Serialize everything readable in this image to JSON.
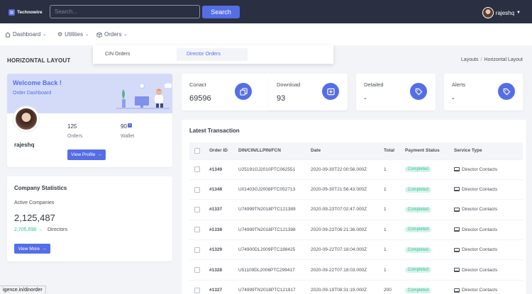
{
  "brand": {
    "name": "Technowire"
  },
  "search": {
    "placeholder": "Search...",
    "button_label": "Search"
  },
  "user": {
    "name": "rajeshq"
  },
  "nav": {
    "items": [
      {
        "label": "Dashboard",
        "icon": "home-icon"
      },
      {
        "label": "Utilities",
        "icon": "gear-icon"
      },
      {
        "label": "Orders",
        "icon": "box-icon"
      }
    ]
  },
  "orders_menu": {
    "items": [
      "CIN Orders",
      "Director Orders"
    ],
    "active": "Director Orders"
  },
  "page": {
    "title": "HORIZONTAL LAYOUT",
    "breadcrumb": [
      "Layouts",
      "Horizontal Layout"
    ]
  },
  "welcome": {
    "title": "Welcome Back !",
    "subtitle": "Order Dashboard",
    "name": "rajeshq",
    "orders_value": "125",
    "orders_label": "Orders",
    "wallet_value": "90",
    "wallet_label": "Wallet",
    "button_label": "View Profile"
  },
  "stats": [
    {
      "label": "Conact",
      "value": "69596",
      "icon": "copy-icon"
    },
    {
      "label": "Download",
      "value": "93",
      "icon": "download-box-icon"
    },
    {
      "label": "Detailed",
      "value": "-",
      "icon": "tag-icon"
    },
    {
      "label": "Alerts",
      "value": "-",
      "icon": "tag-icon"
    }
  ],
  "company": {
    "title": "Company Statistics",
    "subtitle": "Active Companies",
    "value": "2,125,487",
    "growth": "2,705,698",
    "growth_label": "Directors",
    "button_label": "View More"
  },
  "transactions": {
    "title": "Latest Transaction",
    "columns": [
      "",
      "Order ID",
      "DIN/CIN/LLPIN/FCN",
      "Date",
      "Total",
      "Payment Status",
      "Service Type"
    ],
    "rows": [
      {
        "id": "#1349",
        "ref": "U25191GJ2010PTC062551",
        "date": "2020-09-30T22:00:56.000Z",
        "total": "1",
        "status": "Completed",
        "service": "Director Contacts"
      },
      {
        "id": "#1348",
        "ref": "U01403GJ2008PTC052713",
        "date": "2020-09-30T21:56:43.000Z",
        "total": "1",
        "status": "Completed",
        "service": "Director Contacts"
      },
      {
        "id": "#1337",
        "ref": "U74999TN2018PTC121389",
        "date": "2020-09-23T07:02:47.000Z",
        "total": "1",
        "status": "Completed",
        "service": "Director Contacts"
      },
      {
        "id": "#1338",
        "ref": "U74999TN2018PTC121398",
        "date": "2020-09-23T06:21:36.000Z",
        "total": "1",
        "status": "Completed",
        "service": "Director Contacts"
      },
      {
        "id": "#1329",
        "ref": "U74900DL2009PTC188425",
        "date": "2020-09-22T07:18:04.000Z",
        "total": "1",
        "status": "Completed",
        "service": "Director Contacts"
      },
      {
        "id": "#1328",
        "ref": "U51109DL2006PTC299417",
        "date": "2020-09-22T07:18:03.000Z",
        "total": "1",
        "status": "Completed",
        "service": "Director Contacts"
      },
      {
        "id": "#1327",
        "ref": "U74999TN2018PTC121917",
        "date": "2020-09-19T08:31:19.000Z",
        "total": "200",
        "status": "Completed",
        "service": "Director Contacts"
      }
    ]
  },
  "statusbar": {
    "url": "igence.in/dinorder"
  },
  "colors": {
    "primary": "#556ee6",
    "topbar": "#2a3042",
    "success": "#34c38f",
    "welcome_bg": "#d4dbf9",
    "page_bg": "#f3f4f8"
  }
}
